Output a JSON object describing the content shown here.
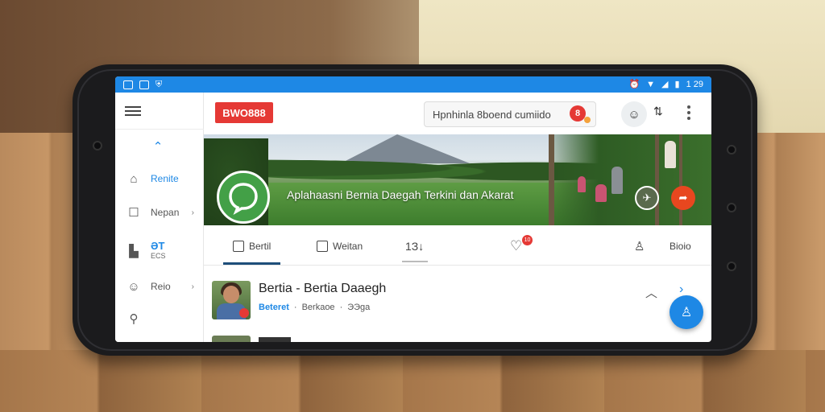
{
  "status_bar": {
    "time": "1 29"
  },
  "header": {
    "logo_text": "BWO888",
    "search_text": "Hpnhinla 8boend cumiido",
    "search_badge": "8"
  },
  "sidebar": {
    "items": [
      {
        "label": "Renite"
      },
      {
        "label": "Nepan"
      },
      {
        "label_top": "ƏT",
        "label_bottom": "ECS"
      },
      {
        "label": "Reio"
      }
    ]
  },
  "banner": {
    "title": "Aplahaasni Bernia Daegah Terkini dan Akarat"
  },
  "tabs": [
    {
      "label": "Bertil"
    },
    {
      "label": "Weitan"
    },
    {
      "label": "1З↓"
    },
    {
      "label": "",
      "badge": "10"
    },
    {
      "label": ""
    },
    {
      "label": "Bioio"
    }
  ],
  "feed": {
    "items": [
      {
        "title": "Bertia - Bertia Daaegh",
        "source": "Beteret",
        "meta_1": "Berkaoe",
        "meta_2": "ЭЭgа"
      }
    ]
  },
  "colors": {
    "accent": "#1e88e5",
    "brand": "#e53935",
    "banner_avatar": "#43a047"
  }
}
